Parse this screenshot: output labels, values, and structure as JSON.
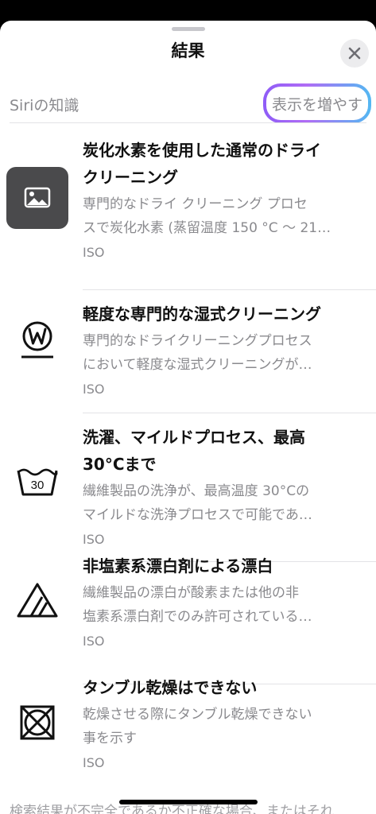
{
  "sheet": {
    "title": "結果",
    "close_icon": "close-x-icon"
  },
  "section": {
    "label": "Siriの知識",
    "more_button": "表示を増やす"
  },
  "results": [
    {
      "title_line1": "炭化水素を使用した通常のドライ",
      "title_line2": "クリーニング",
      "desc_line1": "専門的なドライ クリーニング プロセ",
      "desc_line2": "スで炭化水素 (蒸留温度 150 °C ～ 21…",
      "source": "ISO",
      "icon": "image-placeholder-icon"
    },
    {
      "title_line1": "軽度な専門的な湿式クリーニング",
      "title_line2": "",
      "desc_line1": "専門的なドライクリーニングプロセス",
      "desc_line2": "において軽度な湿式クリーニングが…",
      "source": "ISO",
      "icon": "wet-cleaning-w-icon"
    },
    {
      "title_line1": "洗濯、マイルドプロセス、最高",
      "title_line2": "30°Cまで",
      "desc_line1": "繊維製品の洗浄が、最高温度 30°Cの",
      "desc_line2": "マイルドな洗浄プロセスで可能であ…",
      "source": "ISO",
      "icon": "wash-tub-30-icon",
      "icon_text": "30"
    },
    {
      "title_line1": "非塩素系漂白剤による漂白",
      "title_line2": "",
      "desc_line1": "繊維製品の漂白が酸素または他の非",
      "desc_line2": "塩素系漂白剤でのみ許可されている…",
      "source": "ISO",
      "icon": "non-chlorine-bleach-triangle-icon"
    },
    {
      "title_line1": "タンブル乾燥はできない",
      "title_line2": "",
      "desc_line1": "乾燥させる際にタンブル乾燥できない",
      "desc_line2": "事を示す",
      "source": "ISO",
      "icon": "no-tumble-dry-icon"
    }
  ],
  "footer": {
    "text": "検索結果が不完全であるか不正確な場合、またはそれ"
  }
}
